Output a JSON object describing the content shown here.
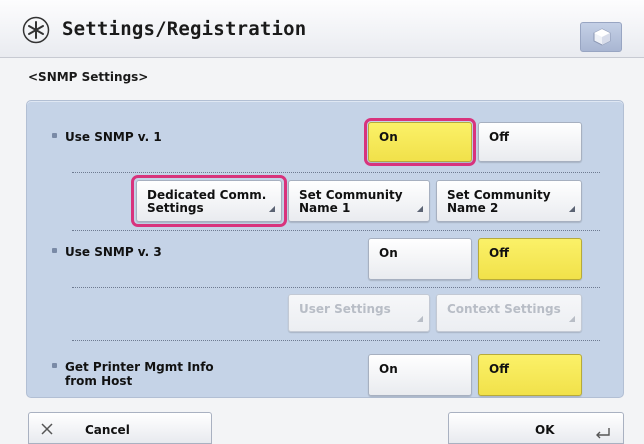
{
  "header": {
    "title": "Settings/Registration",
    "icon": "settings-asterisk-icon",
    "right_button_icon": "counter-check-icon"
  },
  "section_title": "<SNMP Settings>",
  "rows": {
    "snmp_v1": {
      "label": "Use SNMP v. 1",
      "on": "On",
      "off": "Off",
      "selected": "On"
    },
    "v1_sub": {
      "dedicated": [
        "Dedicated Comm.",
        "Settings"
      ],
      "community1": [
        "Set Community",
        "Name 1"
      ],
      "community2": [
        "Set Community",
        "Name 2"
      ]
    },
    "snmp_v3": {
      "label": "Use SNMP v. 3",
      "on": "On",
      "off": "Off",
      "selected": "Off"
    },
    "v3_sub": {
      "user": "User Settings",
      "context": "Context Settings"
    },
    "printer_mgmt": {
      "label_line1": "Get Printer Mgmt Info",
      "label_line2": "from Host",
      "on": "On",
      "off": "Off",
      "selected": "Off"
    }
  },
  "footer": {
    "cancel": "Cancel",
    "ok": "OK"
  },
  "colors": {
    "selected": "#f1e14a",
    "highlight": "#d8337d",
    "panel": "#c5d3e7"
  }
}
